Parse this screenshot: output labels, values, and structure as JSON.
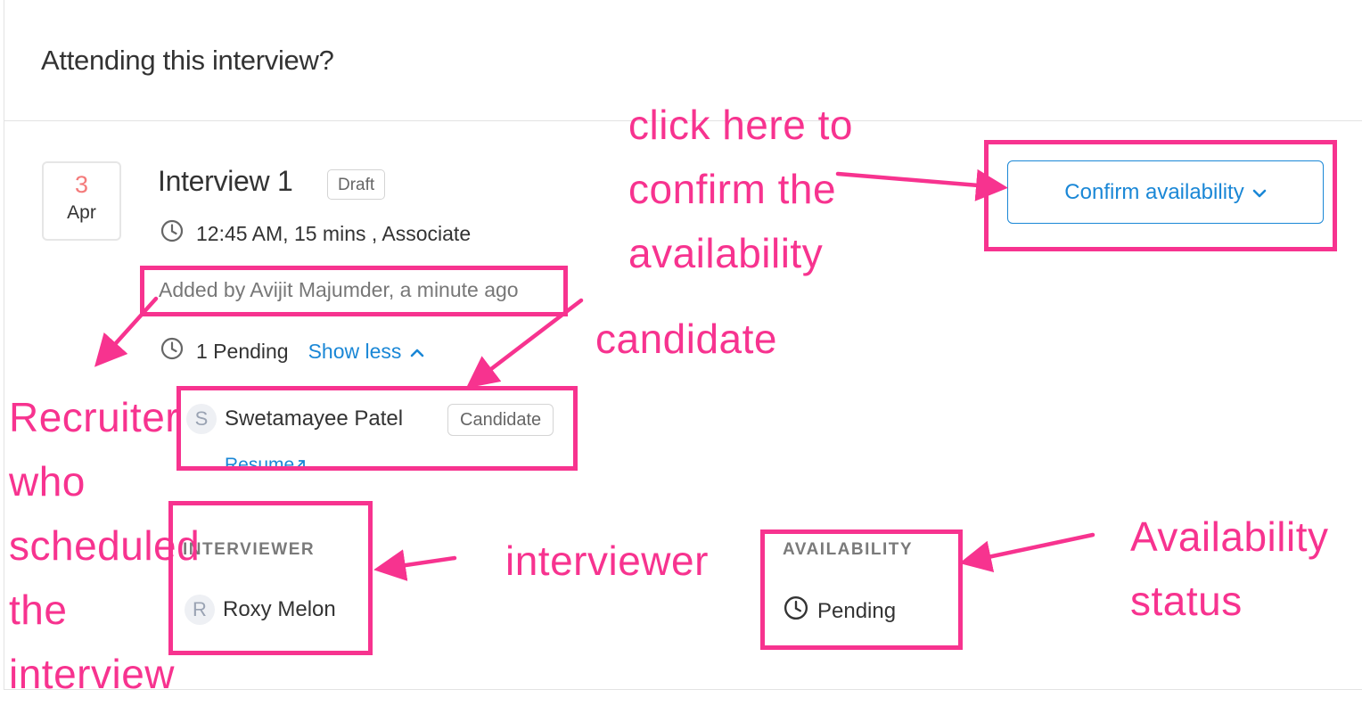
{
  "header": {
    "title": "Attending this interview?"
  },
  "interview": {
    "date_day": "3",
    "date_month": "Apr",
    "title": "Interview 1",
    "status_badge": "Draft",
    "schedule": "12:45 AM, 15 mins , Associate",
    "added_by": "Added by Avijit Majumder, a minute ago",
    "pending_count": "1 Pending",
    "show_less": "Show less"
  },
  "candidate": {
    "avatar_initial": "S",
    "name": "Swetamayee Patel",
    "badge": "Candidate",
    "resume_link": "Resume"
  },
  "interviewer_section": {
    "label": "INTERVIEWER",
    "avatar_initial": "R",
    "name": "Roxy Melon"
  },
  "availability_section": {
    "label": "AVAILABILITY",
    "status": "Pending"
  },
  "actions": {
    "confirm_label": "Confirm availability"
  },
  "annotations": {
    "confirm": [
      "click here to",
      "confirm the",
      "availability"
    ],
    "candidate": "candidate",
    "recruiter": [
      "Recruiter",
      "who",
      "scheduled",
      "the",
      "interview"
    ],
    "interviewer": "interviewer",
    "availability": [
      "Availability",
      "status"
    ],
    "color": "#f7338f"
  },
  "colors": {
    "accent": "#1a87d6",
    "date_day": "#f47b7b",
    "annotation": "#f7338f"
  },
  "icons": [
    "clock-icon",
    "chevron-up-icon",
    "chevron-down-icon",
    "external-link-icon"
  ]
}
